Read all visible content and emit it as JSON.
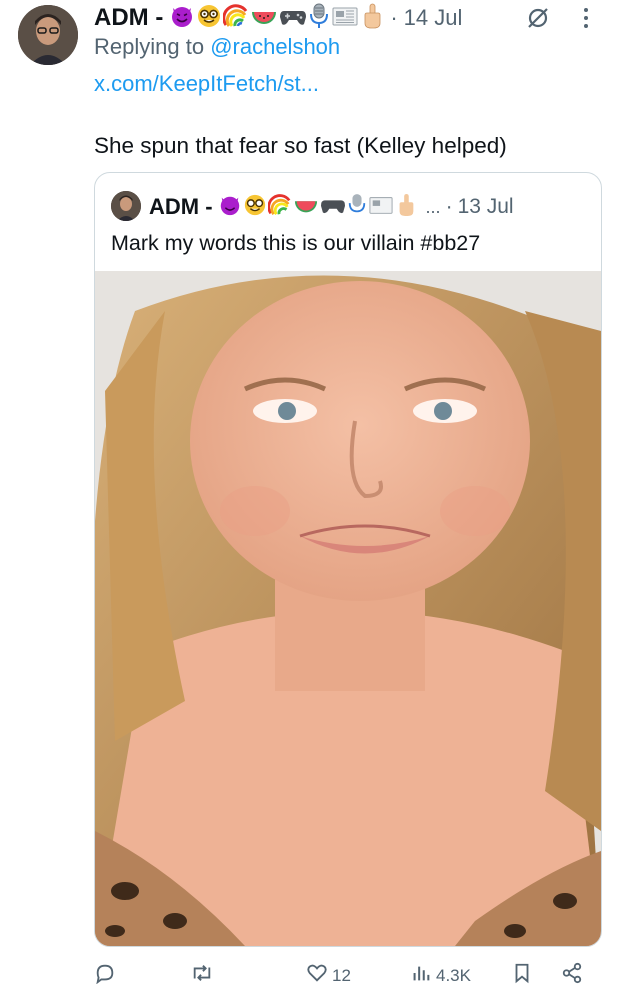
{
  "tweet": {
    "author_name": "ADM -",
    "name_emojis": [
      "smiling-devil-emoji",
      "nerd-face-emoji",
      "rainbow-emoji",
      "watermelon-emoji",
      "game-controller-emoji",
      "microphone-emoji",
      "newspaper-emoji",
      "middle-finger-emoji"
    ],
    "separator": "·",
    "timestamp": "14 Jul",
    "replying_prefix": "Replying to ",
    "replying_handle": "@rachelshoh",
    "link_text": "x.com/KeepItFetch/st...",
    "text": "She spun that fear so fast (Kelley helped)"
  },
  "quoted": {
    "author_name": "ADM -",
    "name_emojis": [
      "smiling-devil-emoji",
      "nerd-face-emoji",
      "rainbow-emoji",
      "watermelon-emoji",
      "game-controller-emoji",
      "microphone-emoji",
      "newspaper-emoji",
      "middle-finger-emoji"
    ],
    "ellipsis": "...",
    "separator": "·",
    "timestamp": "13 Jul",
    "text": "Mark my words this is our villain #bb27"
  },
  "actions": {
    "reply_icon": "speech-bubble-icon",
    "retweet_icon": "retweet-icon",
    "like_icon": "heart-icon",
    "like_count": "12",
    "views_icon": "bar-chart-icon",
    "views_count": "4.3K",
    "bookmark_icon": "bookmark-icon",
    "share_icon": "share-icon"
  },
  "colors": {
    "link": "#1d9bf0",
    "secondary_text": "#536471",
    "primary_text": "#0f1419",
    "border": "#cfd9de"
  }
}
